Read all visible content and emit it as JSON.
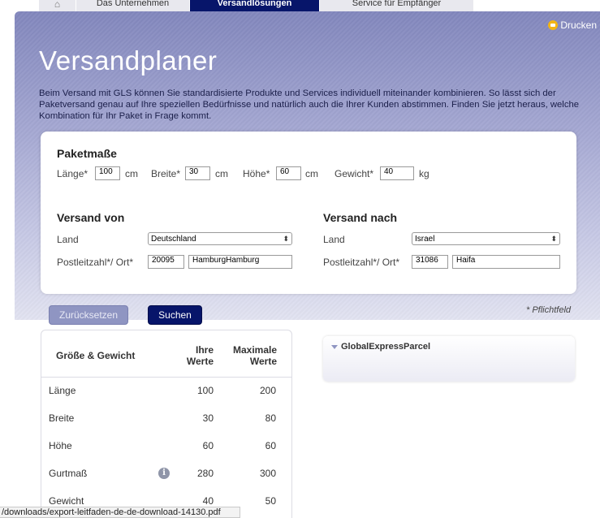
{
  "nav": {
    "home_icon": "home-icon",
    "tabs": [
      "Das Unternehmen",
      "Versandlösungen",
      "Service für Empfänger"
    ]
  },
  "print_label": "Drucken",
  "title": "Versandplaner",
  "intro": "Beim Versand mit GLS können Sie standardisierte Produkte und Services individuell miteinander kombinieren. So lässt sich der Paketversand genau auf Ihre speziellen Bedürfnisse und natürlich auch die Ihrer Kunden abstimmen. Finden Sie jetzt heraus, welche Kombination für Ihr Paket in Frage kommt.",
  "paket": {
    "heading": "Paketmaße",
    "laenge_label": "Länge*",
    "laenge_value": "100",
    "laenge_unit": "cm",
    "breite_label": "Breite*",
    "breite_value": "30",
    "breite_unit": "cm",
    "hoehe_label": "Höhe*",
    "hoehe_value": "60",
    "hoehe_unit": "cm",
    "gewicht_label": "Gewicht*",
    "gewicht_value": "40",
    "gewicht_unit": "kg"
  },
  "von": {
    "heading": "Versand von",
    "land_label": "Land",
    "land_value": "Deutschland",
    "plz_label": "Postleitzahl*/ Ort*",
    "plz_value": "20095",
    "ort_value": "HamburgHamburg"
  },
  "nach": {
    "heading": "Versand nach",
    "land_label": "Land",
    "land_value": "Israel",
    "plz_label": "Postleitzahl*/ Ort*",
    "plz_value": "31086",
    "ort_value": "Haifa"
  },
  "buttons": {
    "reset": "Zurücksetzen",
    "search": "Suchen"
  },
  "required_note": "* Pflichtfeld",
  "table": {
    "col1": "Größe & Gewicht",
    "col2_line1": "Ihre",
    "col2_line2": "Werte",
    "col3_line1": "Maximale",
    "col3_line2": "Werte",
    "rows": [
      {
        "label": "Länge",
        "yours": "100",
        "max": "200"
      },
      {
        "label": "Breite",
        "yours": "30",
        "max": "80"
      },
      {
        "label": "Höhe",
        "yours": "60",
        "max": "60"
      },
      {
        "label": "Gurtmaß",
        "yours": "280",
        "max": "300",
        "info": "info-icon"
      },
      {
        "label": "Gewicht",
        "yours": "40",
        "max": "50"
      }
    ]
  },
  "result": {
    "title": "GlobalExpressParcel"
  },
  "status_url": "/downloads/export-leitfaden-de-de-download-14130.pdf"
}
